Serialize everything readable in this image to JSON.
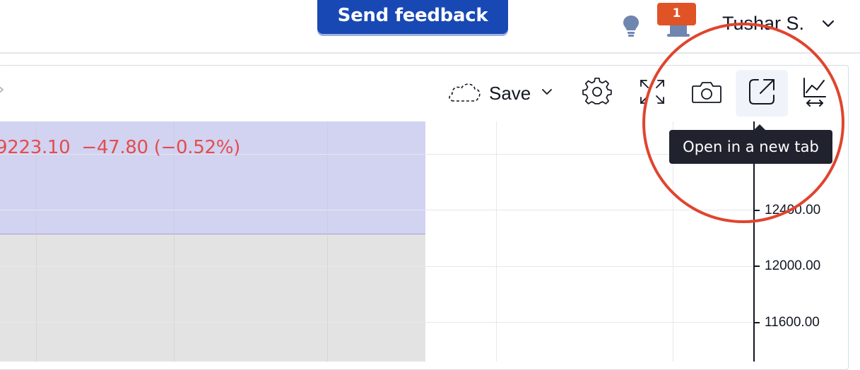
{
  "header": {
    "feedback_label": "Send feedback",
    "notification_count": "1",
    "user_name": "Tushar S."
  },
  "chart": {
    "price_text": "9223.10  −47.80 (−0.52%)",
    "axis_labels": [
      "12400.00",
      "12000.00",
      "11600.00"
    ]
  },
  "toolbar": {
    "save_label": "Save",
    "tooltip": "Open in a new tab"
  },
  "colors": {
    "feedback_bg": "#1848b4",
    "badge_bg": "#e05326",
    "price_text": "#e34d4d",
    "violet_region": "#d2d2f1",
    "annotation": "#e0442e",
    "tooltip_bg": "#20232e"
  },
  "icons": {
    "header": [
      "lightbulb-icon",
      "bell-icon",
      "chevron-down-icon"
    ],
    "toolbar": [
      "cloud-icon",
      "chevron-down-icon",
      "gear-icon",
      "fullscreen-icon",
      "camera-icon",
      "open-new-tab-icon",
      "chart-scale-icon"
    ]
  }
}
